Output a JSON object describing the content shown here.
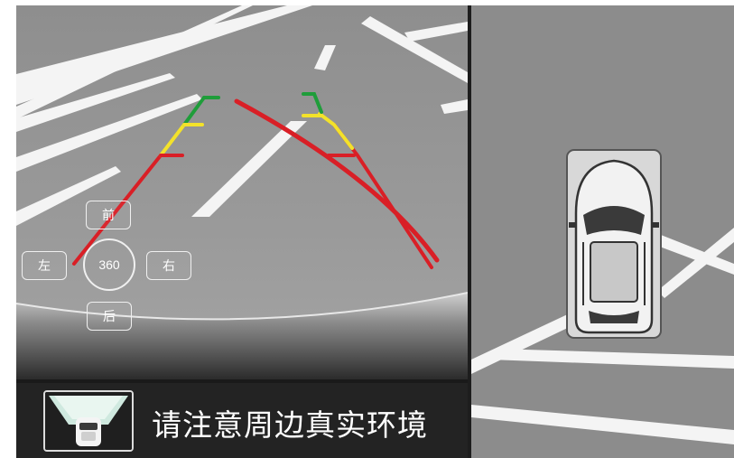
{
  "view_controls": {
    "front_label": "前",
    "left_label": "左",
    "center_label": "360",
    "right_label": "右",
    "rear_label": "后"
  },
  "warning": {
    "message": "请注意周边真实环境",
    "icon": "car-top-view-icon"
  },
  "colors": {
    "guide_red": "#d91f26",
    "guide_yellow": "#f3e22a",
    "guide_green": "#1f9d3a",
    "ground_gray": "#8c8c8c",
    "warning_bar": "#232323"
  }
}
